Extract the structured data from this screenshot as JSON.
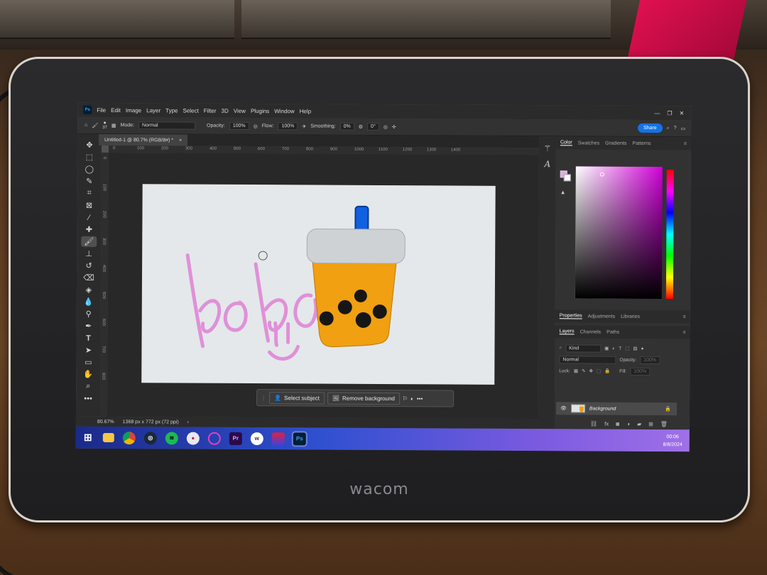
{
  "device": {
    "brand": "wacom"
  },
  "menu": [
    "File",
    "Edit",
    "Image",
    "Layer",
    "Type",
    "Select",
    "Filter",
    "3D",
    "View",
    "Plugins",
    "Window",
    "Help"
  ],
  "options": {
    "mode_label": "Mode:",
    "mode_value": "Normal",
    "opacity_label": "Opacity:",
    "opacity_value": "100%",
    "flow_label": "Flow:",
    "flow_value": "100%",
    "smoothing_label": "Smoothing:",
    "smoothing_value": "0%",
    "angle_value": "0°",
    "brush_size": "37",
    "share_label": "Share"
  },
  "document_tab": {
    "title": "Untitled-1 @ 80.7% (RGB/8#) *",
    "close": "×"
  },
  "ruler_h": [
    "0",
    "100",
    "200",
    "300",
    "400",
    "500",
    "600",
    "700",
    "800",
    "900",
    "1000",
    "1100",
    "1200",
    "1300",
    "1400"
  ],
  "ruler_v": [
    "0",
    "100",
    "200",
    "300",
    "400",
    "500",
    "600",
    "700",
    "800"
  ],
  "context_bar": {
    "select_subject": "Select subject",
    "remove_background": "Remove background",
    "more": "•••"
  },
  "status": {
    "zoom": "80.67%",
    "doc_size": "1368 px x 772 px (72 ppi)"
  },
  "color_panel": {
    "tabs": [
      "Color",
      "Swatches",
      "Gradients",
      "Patterns"
    ],
    "fg_color": "#e8a8e8"
  },
  "props_panel": {
    "tabs": [
      "Properties",
      "Adjustments",
      "Libraries"
    ]
  },
  "layers_panel": {
    "tabs": [
      "Layers",
      "Channels",
      "Paths"
    ],
    "kind_label": "Kind",
    "blend_mode": "Normal",
    "opacity_label": "Opacity:",
    "opacity_value": "100%",
    "lock_label": "Lock:",
    "fill_label": "Fill:",
    "fill_value": "100%",
    "layers": [
      {
        "name": "Background",
        "visible": true,
        "locked": true
      }
    ]
  },
  "artwork": {
    "text": "boba",
    "text_color": "#e090d8",
    "cup_color": "#f0a010",
    "lid_color": "#cfd2d4",
    "straw_color": "#1060e0"
  },
  "taskbar": {
    "apps": [
      "start-icon",
      "file-explorer-icon",
      "chrome-icon",
      "steam-icon",
      "spotify-icon",
      "discord-icon",
      "app-icon",
      "premiere-icon",
      "wacom-center-icon",
      "app-icon",
      "photoshop-icon"
    ],
    "time": "00:06",
    "date": "8/8/2024"
  }
}
